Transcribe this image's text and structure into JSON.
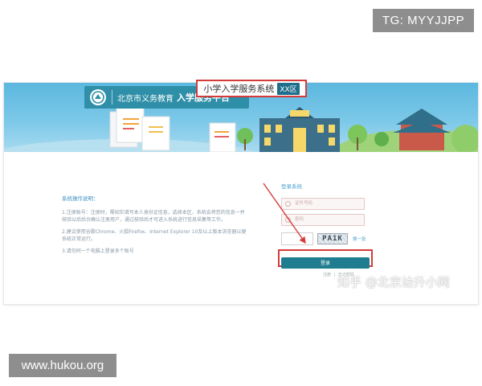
{
  "watermarks": {
    "telegram": "TG: MYYJJPP",
    "site": "www.hukou.org",
    "zhihu": "知乎 @北京幼升小网"
  },
  "banner": {
    "org_name": "北京市义务教育",
    "platform_name": "入学服务平台",
    "icons": [
      "emblem-icon",
      "document-illustration",
      "school-building-illustration",
      "temple-illustration",
      "tree-illustration"
    ]
  },
  "system": {
    "title": "小学入学服务系统",
    "district": "XX区"
  },
  "instructions": {
    "heading": "系统操作说明：",
    "items": [
      "1.注册账号：注册时，需如实填写本人身份证信息，选择本区，系统会将您的信息一并核验以后后台确认注册用户，通过核验后才可进入系统进行信息采集等工作。",
      "2.建议使用谷歌Chrome、火狐Firefox、Internet Explorer 10及以上版本浏览器以便系统正常运行。",
      "3.请勿同一个电脑上登录多个账号"
    ],
    "browser_link": "谷歌Chrome、火狐Firefox、Internet Explorer 10及以上版本"
  },
  "login": {
    "title": "登录系统",
    "username_placeholder": "证件号码",
    "password_placeholder": "密码",
    "captcha_text": "PA1K",
    "refresh_label": "换一张",
    "submit_label": "登录",
    "register_label": "注册",
    "forgot_label": "忘记密码"
  },
  "colors": {
    "highlight_red": "#d63b3b",
    "button_teal": "#1f7d8f",
    "banner_blue": "#5cb8df"
  }
}
